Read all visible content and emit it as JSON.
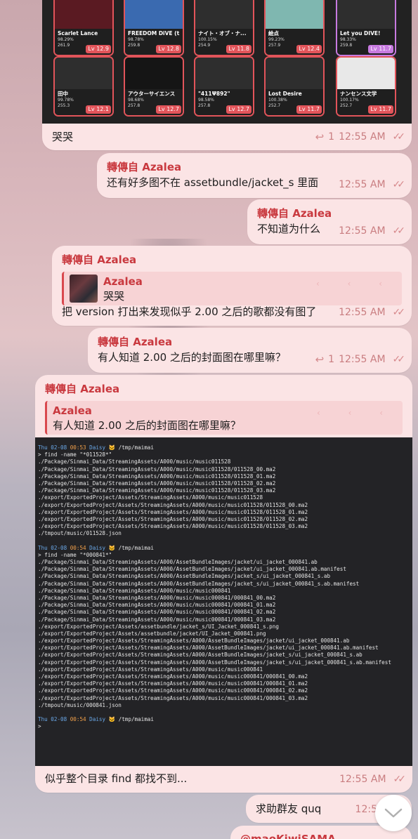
{
  "colors": {
    "accent": "#c9393f",
    "bubble": "#fbe4e5",
    "terminal_bg": "#232326"
  },
  "image_grid": {
    "cards": [
      {
        "title": "Scarlet Lance",
        "score": "98.29%",
        "rating": "261.9",
        "level": "Lv 12.9",
        "color": "#5a1a22"
      },
      {
        "title": "FREEDOM DiVE (t...",
        "score": "98.78%",
        "rating": "259.8",
        "level": "Lv 12.8",
        "color": "#3a6ab0"
      },
      {
        "title": "ナイト・オブ・ナ...",
        "score": "100.15%",
        "rating": "254.9",
        "level": "Lv 11.8",
        "color": "#2e2e2e"
      },
      {
        "title": "絵点",
        "score": "99.23%",
        "rating": "257.9",
        "level": "Lv 12.4",
        "color": "#7fb7b0"
      },
      {
        "title": "Let you DIVE!",
        "score": "98.33%",
        "rating": "259.8",
        "level": "Lv 11.7",
        "color": "#2e2e2e"
      },
      {
        "title": "田中",
        "score": "99.78%",
        "rating": "255.3",
        "level": "Lv 12.1",
        "color": "#2e2e2e"
      },
      {
        "title": "アウターサイエンス",
        "score": "98.68%",
        "rating": "257.8",
        "level": "Lv 12.7",
        "color": "#151515"
      },
      {
        "title": "\"411Ψ892\"",
        "score": "98.58%",
        "rating": "257.8",
        "level": "Lv 12.7",
        "color": "#2e2e2e"
      },
      {
        "title": "Lost Desire",
        "score": "100.38%",
        "rating": "252.7",
        "level": "Lv 11.7",
        "color": "#2e2e2e"
      },
      {
        "title": "ナンセンス文学",
        "score": "100.17%",
        "rating": "252.7",
        "level": "Lv 11.7",
        "color": "#e8e8e8"
      }
    ]
  },
  "messages": {
    "m1": {
      "text": "哭哭",
      "reply_count": "1",
      "time": "12:55 AM"
    },
    "m2": {
      "forwarded_from": "轉傳自 Azalea",
      "text": "还有好多图不在 assetbundle/jacket_s 里面",
      "time": "12:55 AM"
    },
    "m3": {
      "forwarded_from": "轉傳自 Azalea",
      "text": "不知道为什么",
      "time": "12:55 AM"
    },
    "m4": {
      "forwarded_from": "轉傳自 Azalea",
      "quote_name": "Azalea",
      "quote_text": "哭哭",
      "text": "把 version 打出来发现似乎 2.00 之后的歌都没有图了",
      "time": "12:55 AM"
    },
    "m5": {
      "forwarded_from": "轉傳自 Azalea",
      "text": "有人知道 2.00 之后的封面图在哪里嘛？",
      "reply_count": "1",
      "time": "12:55 AM"
    },
    "m6": {
      "forwarded_from": "轉傳自 Azalea",
      "quote_name": "Azalea",
      "quote_text": "有人知道 2.00 之后的封面图在哪里嘛？"
    },
    "m7": {
      "caption": "似乎整个目录 find 都找不到...",
      "time": "12:55 AM"
    },
    "m8": {
      "text": "求助群友 quq",
      "time": "12:55 AM"
    },
    "m9": {
      "sender": "@maoKiwiSAMA"
    }
  },
  "terminal": {
    "p1": {
      "date": "Thu 02-08",
      "time": "00:53",
      "user": "Daisy",
      "path": "/tmp/maimai"
    },
    "c1": "> find -name \"*011528*\"",
    "out1": [
      "./Package/Sinmai_Data/StreamingAssets/A000/music/music011528",
      "./Package/Sinmai_Data/StreamingAssets/A000/music/music011528/011528_00.ma2",
      "./Package/Sinmai_Data/StreamingAssets/A000/music/music011528/011528_01.ma2",
      "./Package/Sinmai_Data/StreamingAssets/A000/music/music011528/011528_02.ma2",
      "./Package/Sinmai_Data/StreamingAssets/A000/music/music011528/011528_03.ma2",
      "./export/ExportedProject/Assets/StreamingAssets/A000/music/music011528",
      "./export/ExportedProject/Assets/StreamingAssets/A000/music/music011528/011528_00.ma2",
      "./export/ExportedProject/Assets/StreamingAssets/A000/music/music011528/011528_01.ma2",
      "./export/ExportedProject/Assets/StreamingAssets/A000/music/music011528/011528_02.ma2",
      "./export/ExportedProject/Assets/StreamingAssets/A000/music/music011528/011528_03.ma2",
      "./tmpout/music/011528.json"
    ],
    "p2": {
      "date": "Thu 02-08",
      "time": "00:54",
      "user": "Daisy",
      "path": "/tmp/maimai"
    },
    "c2": "> find -name \"*000841*\"",
    "out2": [
      "./Package/Sinmai_Data/StreamingAssets/A000/AssetBundleImages/jacket/ui_jacket_000841.ab",
      "./Package/Sinmai_Data/StreamingAssets/A000/AssetBundleImages/jacket/ui_jacket_000841.ab.manifest",
      "./Package/Sinmai_Data/StreamingAssets/A000/AssetBundleImages/jacket_s/ui_jacket_000841_s.ab",
      "./Package/Sinmai_Data/StreamingAssets/A000/AssetBundleImages/jacket_s/ui_jacket_000841_s.ab.manifest",
      "./Package/Sinmai_Data/StreamingAssets/A000/music/music000841",
      "./Package/Sinmai_Data/StreamingAssets/A000/music/music000841/000841_00.ma2",
      "./Package/Sinmai_Data/StreamingAssets/A000/music/music000841/000841_01.ma2",
      "./Package/Sinmai_Data/StreamingAssets/A000/music/music000841/000841_02.ma2",
      "./Package/Sinmai_Data/StreamingAssets/A000/music/music000841/000841_03.ma2",
      "./export/ExportedProject/Assets/assetbundle/jacket_s/UI_Jacket_000841_s.png",
      "./export/ExportedProject/Assets/assetbundle/jacket/UI_Jacket_000841.png",
      "./export/ExportedProject/Assets/StreamingAssets/A000/AssetBundleImages/jacket/ui_jacket_000841.ab",
      "./export/ExportedProject/Assets/StreamingAssets/A000/AssetBundleImages/jacket/ui_jacket_000841.ab.manifest",
      "./export/ExportedProject/Assets/StreamingAssets/A000/AssetBundleImages/jacket_s/ui_jacket_000841_s.ab",
      "./export/ExportedProject/Assets/StreamingAssets/A000/AssetBundleImages/jacket_s/ui_jacket_000841_s.ab.manifest",
      "./export/ExportedProject/Assets/StreamingAssets/A000/music/music000841",
      "./export/ExportedProject/Assets/StreamingAssets/A000/music/music000841/000841_00.ma2",
      "./export/ExportedProject/Assets/StreamingAssets/A000/music/music000841/000841_01.ma2",
      "./export/ExportedProject/Assets/StreamingAssets/A000/music/music000841/000841_02.ma2",
      "./export/ExportedProject/Assets/StreamingAssets/A000/music/music000841/000841_03.ma2",
      "./tmpout/music/000841.json"
    ],
    "p3": {
      "date": "Thu 02-08",
      "time": "00:54",
      "user": "Daisy",
      "path": "/tmp/maimai"
    },
    "c3": ">"
  },
  "icons": {
    "reply": "reply-arrow-icon",
    "read": "double-check-icon",
    "scroll": "chevron-down-icon"
  }
}
